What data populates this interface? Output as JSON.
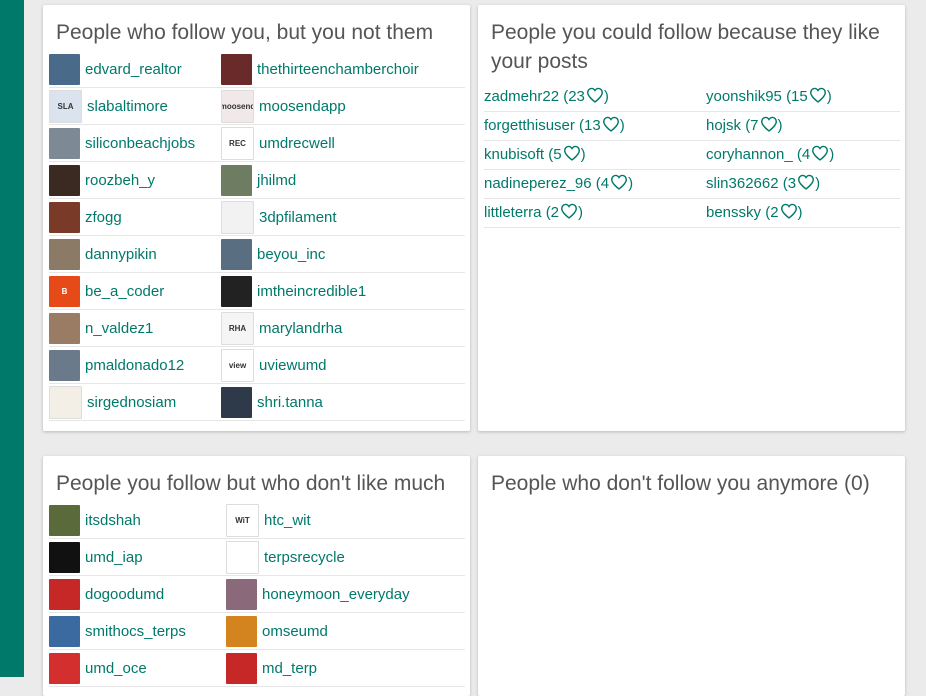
{
  "colors": {
    "accent": "#00796b",
    "title": "#555555",
    "card": "#ffffff",
    "background": "#ebebeb"
  },
  "card1": {
    "title": "People who follow you, but you not them",
    "users": [
      {
        "name": "edvard_realtor",
        "avatar": "#4a6a8a"
      },
      {
        "name": "thethirteenchamberchoir",
        "avatar": "#6b2a2a"
      },
      {
        "name": "slabaltimore",
        "avatar": "#dbe4ee",
        "label": "SLA"
      },
      {
        "name": "moosendapp",
        "avatar": "#f1e9e9",
        "label": "moosend"
      },
      {
        "name": "siliconbeachjobs",
        "avatar": "#7d8a95"
      },
      {
        "name": "umdrecwell",
        "avatar": "#ffffff",
        "label": "REC"
      },
      {
        "name": "roozbeh_y",
        "avatar": "#3a2a22"
      },
      {
        "name": "jhilmd",
        "avatar": "#6e7c62"
      },
      {
        "name": "zfogg",
        "avatar": "#7a3a28"
      },
      {
        "name": "3dpfilament",
        "avatar": "#f2f2f2"
      },
      {
        "name": "dannypikin",
        "avatar": "#8b7a66"
      },
      {
        "name": "beyou_inc",
        "avatar": "#5a6e82"
      },
      {
        "name": "be_a_coder",
        "avatar": "#e64a19",
        "label": "B"
      },
      {
        "name": "imtheincredible1",
        "avatar": "#222222"
      },
      {
        "name": "n_valdez1",
        "avatar": "#9a7b63"
      },
      {
        "name": "marylandrha",
        "avatar": "#f5f5f5",
        "label": "RHA"
      },
      {
        "name": "pmaldonado12",
        "avatar": "#6a7a8a"
      },
      {
        "name": "uviewumd",
        "avatar": "#ffffff",
        "label": "view"
      },
      {
        "name": "sirgednosiam",
        "avatar": "#f4efe6"
      },
      {
        "name": "shri.tanna",
        "avatar": "#2e3a4a"
      }
    ]
  },
  "card2": {
    "title": "People you could follow because they like your posts",
    "likers": [
      {
        "name": "zadmehr22",
        "count": "(23"
      },
      {
        "name": "yoonshik95",
        "count": "(15"
      },
      {
        "name": "forgetthisuser",
        "count": "(13"
      },
      {
        "name": "hojsk",
        "count": "(7"
      },
      {
        "name": "knubisoft",
        "count": "(5"
      },
      {
        "name": "coryhannon_",
        "count": "(4"
      },
      {
        "name": "nadineperez_96",
        "count": "(4"
      },
      {
        "name": "slin362662",
        "count": "(3"
      },
      {
        "name": "littleterra",
        "count": "(2"
      },
      {
        "name": "benssky",
        "count": "(2"
      }
    ]
  },
  "card3": {
    "title": "People you follow but who don't like much",
    "users": [
      {
        "name": "itsdshah",
        "avatar": "#5a6a3a"
      },
      {
        "name": "htc_wit",
        "avatar": "#ffffff",
        "label": "WiT"
      },
      {
        "name": "umd_iap",
        "avatar": "#111111"
      },
      {
        "name": "terpsrecycle",
        "avatar": "#ffffff"
      },
      {
        "name": "dogoodumd",
        "avatar": "#c62828"
      },
      {
        "name": "honeymoon_everyday",
        "avatar": "#8a6a7a"
      },
      {
        "name": "smithocs_terps",
        "avatar": "#3a6aa0"
      },
      {
        "name": "omseumd",
        "avatar": "#d4841f"
      },
      {
        "name": "umd_oce",
        "avatar": "#d32f2f"
      },
      {
        "name": "md_terp",
        "avatar": "#c62828"
      }
    ]
  },
  "card4": {
    "title": "People who don't follow you anymore (0)"
  }
}
